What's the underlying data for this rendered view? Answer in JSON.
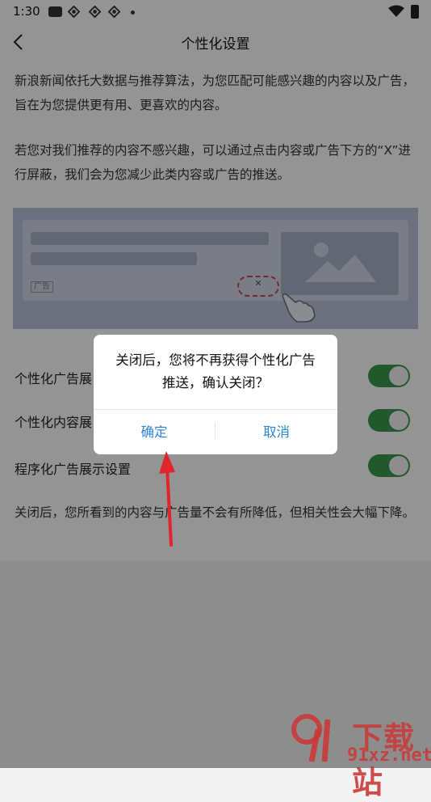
{
  "status": {
    "time": "1:30"
  },
  "nav": {
    "title": "个性化设置"
  },
  "intro": {
    "para1": " 新浪新闻依托大数据与推荐算法，为您匹配可能感兴趣的内容以及广告，旨在为您提供更有用、更喜欢的内容。",
    "para2": "若您对我们推荐的内容不感兴趣，可以通过点击内容或广告下方的“X”进行屏蔽，我们会为您减少此类内容或广告的推送。"
  },
  "illustration": {
    "ad_tag": "广告",
    "close_mark": "✕"
  },
  "settings": [
    {
      "label": "个性化广告展",
      "on": true
    },
    {
      "label": "个性化内容展",
      "on": true
    },
    {
      "label": "程序化广告展示设置",
      "on": true
    }
  ],
  "footer_note": "关闭后，您所看到的内容与广告量不会有所降低，但相关性会大幅下降。",
  "dialog": {
    "message": "关闭后，您将不再获得个性化广告推送，确认关闭？",
    "confirm": "确定",
    "cancel": "取消"
  },
  "watermark": {
    "brand": "下载站",
    "domain": "91xz.net"
  },
  "colors": {
    "accent": "#2f87d6",
    "toggle_on": "#3a9a4c",
    "arrow": "#e0262b"
  }
}
